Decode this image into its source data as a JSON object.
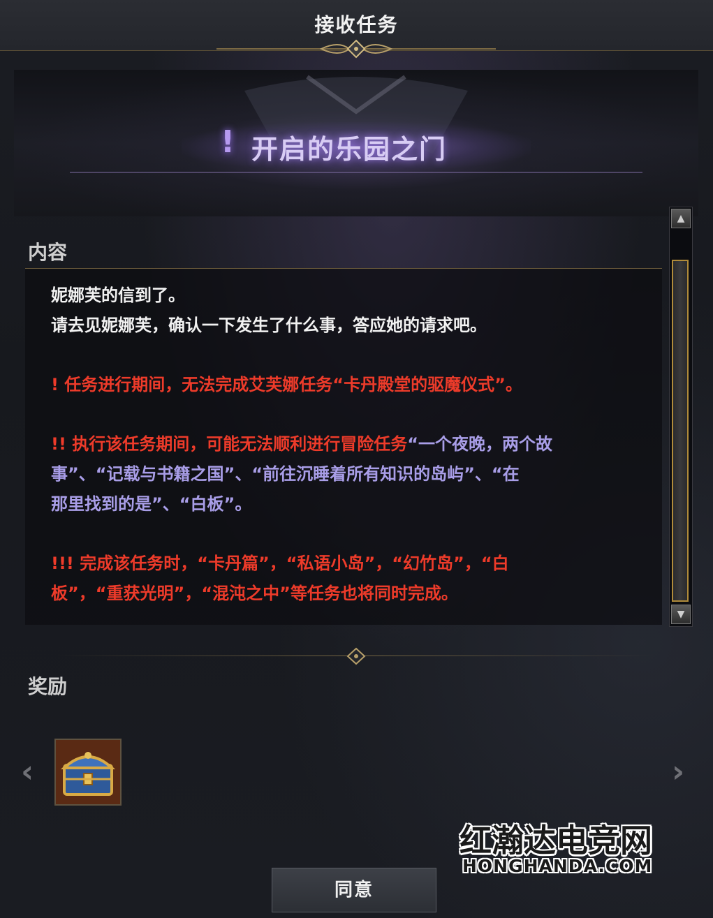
{
  "window": {
    "title": "接收任务"
  },
  "quest": {
    "marker": "!",
    "title": "开启的乐园之门"
  },
  "content": {
    "label": "内容",
    "lines": [
      {
        "text": "妮娜芙的信到了。",
        "style": "white"
      },
      {
        "text": "请去见妮娜芙，确认一下发生了什么事，答应她的请求吧。",
        "style": "white"
      },
      {
        "text": "! 任务进行期间，无法完成艾芙娜任务“卡丹殿堂的驱魔仪式”。",
        "style": "red"
      },
      {
        "prefix": "!! 执行该任务期间，可能无法顺利进行冒险任务",
        "text": "“一个夜晚，两个故",
        "style": "mixed"
      },
      {
        "text": "事”、“记载与书籍之国”、“前往沉睡着所有知识的岛屿”、“在",
        "style": "purple"
      },
      {
        "text": "那里找到的是”、“白板”。",
        "style": "purple"
      },
      {
        "text": "!!! 完成该任务时，“卡丹篇”，“私语小岛”，“幻竹岛”，“白",
        "style": "red"
      },
      {
        "text": "板”，“重获光明”，“混沌之中”等任务也将同时完成。",
        "style": "red"
      }
    ]
  },
  "rewards": {
    "label": "奖励",
    "items": [
      {
        "icon": "treasure-chest-icon"
      }
    ]
  },
  "buttons": {
    "agree": "同意"
  },
  "watermark": {
    "cn": "红瀚达电竞网",
    "en": "HONGHANDA.COM"
  },
  "colors": {
    "red_text": "#ee3b2a",
    "purple_text": "#a99ee8",
    "gold_accent": "#b08b3a"
  }
}
